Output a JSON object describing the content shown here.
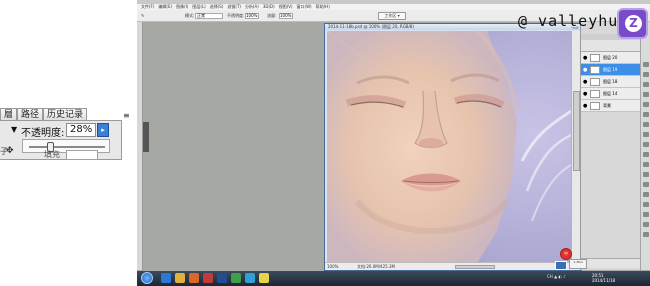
{
  "inset": {
    "tabs": [
      "層",
      "路径",
      "历史记录"
    ],
    "menu_icon": "panel-menu-icon",
    "blend_arrow": "▼",
    "opacity_label": "不透明度:",
    "opacity_value": "28%",
    "opacity_percent": 28,
    "slider_button_glyph": "▸",
    "move_glyph": "✥",
    "left_clip": "子",
    "fill_label": "填充"
  },
  "photoshop": {
    "menu_items": [
      "文件(F)",
      "编辑(E)",
      "图像(I)",
      "图层(L)",
      "选择(S)",
      "滤镜(T)",
      "分析(A)",
      "3D(D)",
      "视图(V)",
      "窗口(W)",
      "帮助(H)"
    ],
    "options": {
      "mode_label": "模式:",
      "mode_value": "正常",
      "opacity_label": "不透明度:",
      "opacity_value": "100%",
      "flow_label": "流量:",
      "flow_value": "100%",
      "workspace_button": "工作区 ▾"
    },
    "document": {
      "title": "2014-11-18b.psd @ 100% (图层 20, RGB/8)",
      "zoom": "100%",
      "status_info": "文档:26.0M/425.3M"
    },
    "layers": [
      {
        "name": "图层 20",
        "selected": false
      },
      {
        "name": "图层 19",
        "selected": true
      },
      {
        "name": "图层 18",
        "selected": false
      },
      {
        "name": "图层 14",
        "selected": false
      },
      {
        "name": "背景",
        "selected": false
      }
    ],
    "bubble_text": "中",
    "popup_note": "1.3K/s"
  },
  "watermark": "@ valleyhu",
  "logo_letter": "Z",
  "taskbar": {
    "tray_time": "20:51",
    "tray_date": "2014/11/18",
    "tray_icons": "CH ▲ ◐ ♪",
    "apps": [
      {
        "icon": "ie-icon",
        "color": "#2b79d6"
      },
      {
        "icon": "folder-icon",
        "color": "#e2b03c"
      },
      {
        "icon": "media-icon",
        "color": "#d9692a"
      },
      {
        "icon": "paint-icon",
        "color": "#c23b3b"
      },
      {
        "icon": "photoshop-icon",
        "color": "#1e4f8f"
      },
      {
        "icon": "browser-icon",
        "color": "#3fa04a"
      },
      {
        "icon": "chat-icon",
        "color": "#2fa0d8"
      },
      {
        "icon": "notes-icon",
        "color": "#e8d447"
      }
    ]
  }
}
